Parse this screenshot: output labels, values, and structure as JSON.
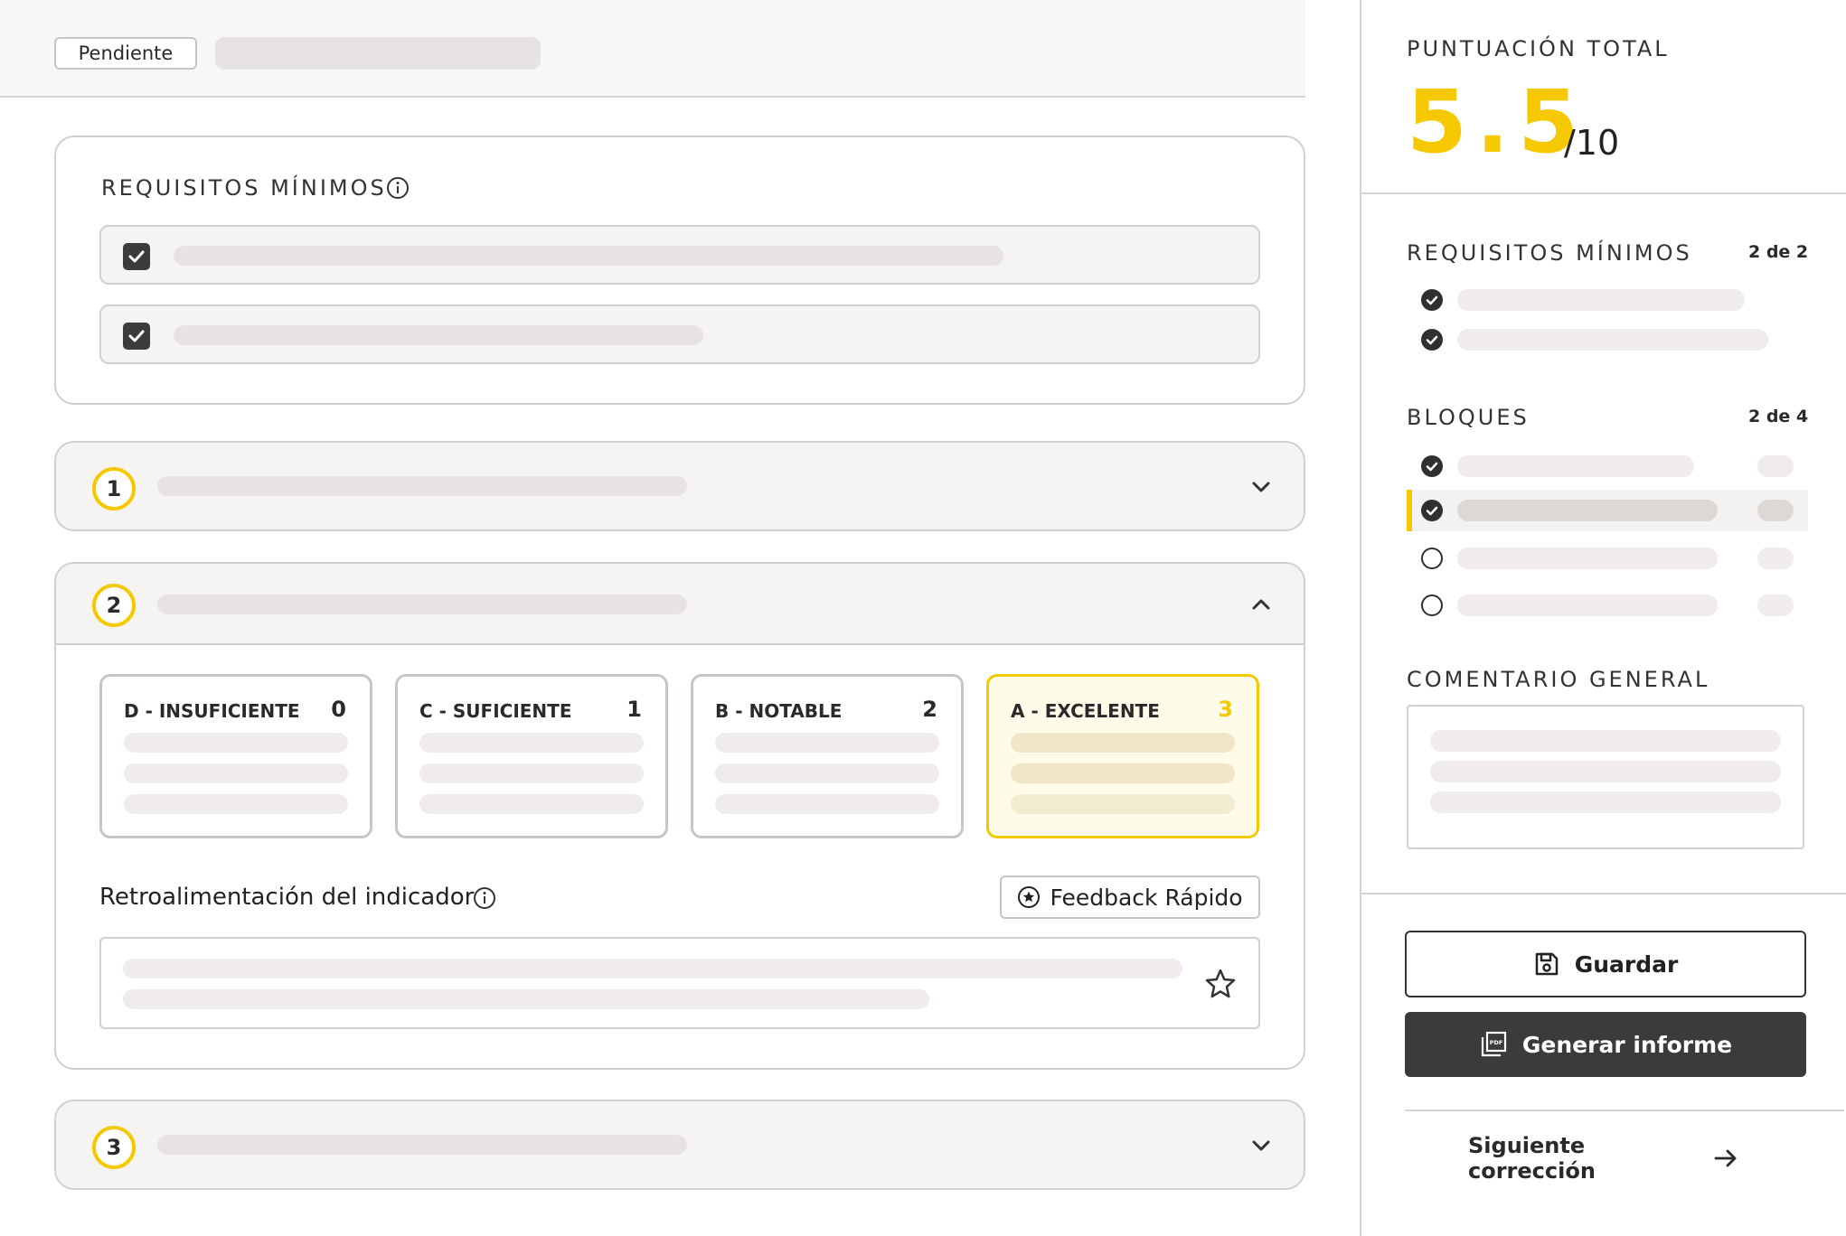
{
  "status_pill": "Pendiente",
  "requirements": {
    "title": "REQUISITOS MÍNIMOS"
  },
  "blocks": [
    {
      "number": "1"
    },
    {
      "number": "2"
    },
    {
      "number": "3"
    }
  ],
  "grades": [
    {
      "label": "D - INSUFICIENTE",
      "score": "0"
    },
    {
      "label": "C - SUFICIENTE",
      "score": "1"
    },
    {
      "label": "B - NOTABLE",
      "score": "2"
    },
    {
      "label": "A - EXCELENTE",
      "score": "3"
    }
  ],
  "feedback": {
    "title": "Retroalimentación del indicador",
    "quick_button": "Feedback Rápido"
  },
  "sidebar": {
    "total_label": "PUNTUACIÓN TOTAL",
    "total_score": "5.5",
    "total_max": "/10",
    "requirements_label": "REQUISITOS MÍNIMOS",
    "requirements_count": "2 de 2",
    "blocks_label": "BLOQUES",
    "blocks_count": "2 de 4",
    "comment_label": "COMENTARIO GENERAL",
    "save_button": "Guardar",
    "report_button": "Generar informe",
    "next_link": "Siguiente corrección"
  },
  "colors": {
    "accent": "#f5c800",
    "dark_button": "#3a3b3c"
  }
}
